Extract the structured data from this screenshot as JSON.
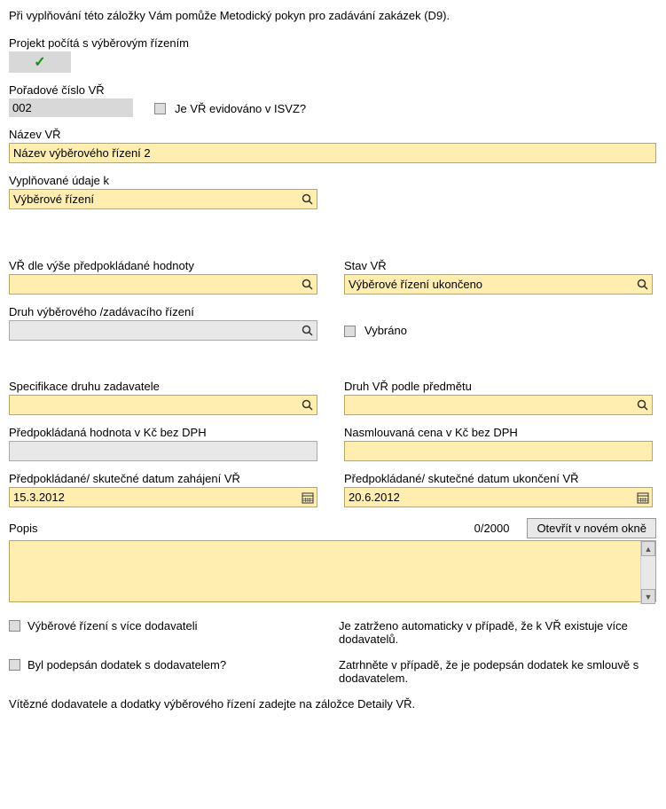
{
  "help_text": "Při vyplňování této záložky Vám pomůže Metodický pokyn pro zadávání zakázek (D9).",
  "projekt_pocita_label": "Projekt počítá s výběrovým řízením",
  "check_glyph": "✓",
  "poradove": {
    "label": "Pořadové číslo VŘ",
    "value": "002"
  },
  "isvz_label": "Je VŘ evidováno v ISVZ?",
  "nazev": {
    "label": "Název VŘ",
    "value": "Název výběrového řízení 2"
  },
  "vyplnovane": {
    "label": "Vyplňované údaje k",
    "value": "Výběrové řízení"
  },
  "vr_vyse": {
    "label": "VŘ dle výše předpokládané hodnoty",
    "value": ""
  },
  "stav": {
    "label": "Stav VŘ",
    "value": "Výběrové řízení ukončeno"
  },
  "druh_zadavaciho": {
    "label": "Druh výběrového /zadávacího řízení",
    "value": ""
  },
  "vybrano_label": "Vybráno",
  "spec_druhu": {
    "label": "Specifikace druhu zadavatele",
    "value": ""
  },
  "druh_predmet": {
    "label": "Druh VŘ podle předmětu",
    "value": ""
  },
  "predpokl_hodnota": {
    "label": "Předpokládaná hodnota v Kč bez DPH",
    "value": ""
  },
  "nasmlouvana": {
    "label": "Nasmlouvaná cena v Kč bez DPH",
    "value": ""
  },
  "datum_zahajeni": {
    "label": "Předpokládané/ skutečné datum zahájení VŘ",
    "value": "15.3.2012"
  },
  "datum_ukonceni": {
    "label": "Předpokládané/ skutečné datum ukončení VŘ",
    "value": "20.6.2012"
  },
  "popis": {
    "label": "Popis",
    "counter": "0/2000",
    "open_btn": "Otevřít v novém okně",
    "value": ""
  },
  "vice_dodavatelu": {
    "label": "Výběrové řízení s více dodavateli",
    "hint": "Je zatrženo automaticky v případě, že k VŘ existuje více dodavatelů."
  },
  "dodatek": {
    "label": "Byl podepsán dodatek s dodavatelem?",
    "hint": "Zatrhněte v případě, že je podepsán dodatek ke smlouvě s dodavatelem."
  },
  "footer_note": "Vítězné dodavatele a dodatky výběrového řízení zadejte na záložce Detaily VŘ."
}
